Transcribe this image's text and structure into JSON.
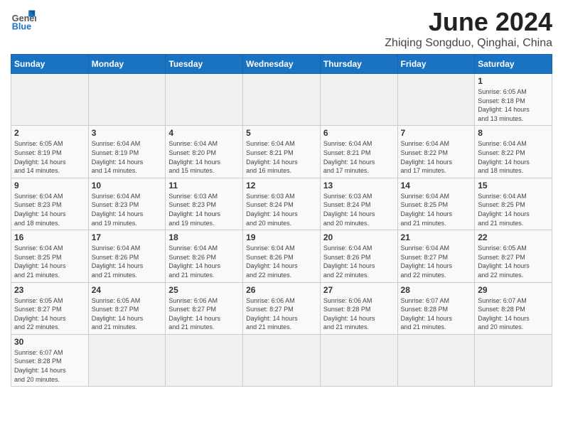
{
  "logo": {
    "text_general": "General",
    "text_blue": "Blue"
  },
  "title": "June 2024",
  "location": "Zhiqing Songduo, Qinghai, China",
  "weekdays": [
    "Sunday",
    "Monday",
    "Tuesday",
    "Wednesday",
    "Thursday",
    "Friday",
    "Saturday"
  ],
  "days": [
    {
      "date": "",
      "info": ""
    },
    {
      "date": "",
      "info": ""
    },
    {
      "date": "",
      "info": ""
    },
    {
      "date": "",
      "info": ""
    },
    {
      "date": "",
      "info": ""
    },
    {
      "date": "",
      "info": ""
    },
    {
      "date": "1",
      "info": "Sunrise: 6:05 AM\nSunset: 8:18 PM\nDaylight: 14 hours\nand 13 minutes."
    },
    {
      "date": "2",
      "info": "Sunrise: 6:05 AM\nSunset: 8:19 PM\nDaylight: 14 hours\nand 14 minutes."
    },
    {
      "date": "3",
      "info": "Sunrise: 6:04 AM\nSunset: 8:19 PM\nDaylight: 14 hours\nand 14 minutes."
    },
    {
      "date": "4",
      "info": "Sunrise: 6:04 AM\nSunset: 8:20 PM\nDaylight: 14 hours\nand 15 minutes."
    },
    {
      "date": "5",
      "info": "Sunrise: 6:04 AM\nSunset: 8:21 PM\nDaylight: 14 hours\nand 16 minutes."
    },
    {
      "date": "6",
      "info": "Sunrise: 6:04 AM\nSunset: 8:21 PM\nDaylight: 14 hours\nand 17 minutes."
    },
    {
      "date": "7",
      "info": "Sunrise: 6:04 AM\nSunset: 8:22 PM\nDaylight: 14 hours\nand 17 minutes."
    },
    {
      "date": "8",
      "info": "Sunrise: 6:04 AM\nSunset: 8:22 PM\nDaylight: 14 hours\nand 18 minutes."
    },
    {
      "date": "9",
      "info": "Sunrise: 6:04 AM\nSunset: 8:23 PM\nDaylight: 14 hours\nand 18 minutes."
    },
    {
      "date": "10",
      "info": "Sunrise: 6:04 AM\nSunset: 8:23 PM\nDaylight: 14 hours\nand 19 minutes."
    },
    {
      "date": "11",
      "info": "Sunrise: 6:03 AM\nSunset: 8:23 PM\nDaylight: 14 hours\nand 19 minutes."
    },
    {
      "date": "12",
      "info": "Sunrise: 6:03 AM\nSunset: 8:24 PM\nDaylight: 14 hours\nand 20 minutes."
    },
    {
      "date": "13",
      "info": "Sunrise: 6:03 AM\nSunset: 8:24 PM\nDaylight: 14 hours\nand 20 minutes."
    },
    {
      "date": "14",
      "info": "Sunrise: 6:04 AM\nSunset: 8:25 PM\nDaylight: 14 hours\nand 21 minutes."
    },
    {
      "date": "15",
      "info": "Sunrise: 6:04 AM\nSunset: 8:25 PM\nDaylight: 14 hours\nand 21 minutes."
    },
    {
      "date": "16",
      "info": "Sunrise: 6:04 AM\nSunset: 8:25 PM\nDaylight: 14 hours\nand 21 minutes."
    },
    {
      "date": "17",
      "info": "Sunrise: 6:04 AM\nSunset: 8:26 PM\nDaylight: 14 hours\nand 21 minutes."
    },
    {
      "date": "18",
      "info": "Sunrise: 6:04 AM\nSunset: 8:26 PM\nDaylight: 14 hours\nand 21 minutes."
    },
    {
      "date": "19",
      "info": "Sunrise: 6:04 AM\nSunset: 8:26 PM\nDaylight: 14 hours\nand 22 minutes."
    },
    {
      "date": "20",
      "info": "Sunrise: 6:04 AM\nSunset: 8:26 PM\nDaylight: 14 hours\nand 22 minutes."
    },
    {
      "date": "21",
      "info": "Sunrise: 6:04 AM\nSunset: 8:27 PM\nDaylight: 14 hours\nand 22 minutes."
    },
    {
      "date": "22",
      "info": "Sunrise: 6:05 AM\nSunset: 8:27 PM\nDaylight: 14 hours\nand 22 minutes."
    },
    {
      "date": "23",
      "info": "Sunrise: 6:05 AM\nSunset: 8:27 PM\nDaylight: 14 hours\nand 22 minutes."
    },
    {
      "date": "24",
      "info": "Sunrise: 6:05 AM\nSunset: 8:27 PM\nDaylight: 14 hours\nand 21 minutes."
    },
    {
      "date": "25",
      "info": "Sunrise: 6:06 AM\nSunset: 8:27 PM\nDaylight: 14 hours\nand 21 minutes."
    },
    {
      "date": "26",
      "info": "Sunrise: 6:06 AM\nSunset: 8:27 PM\nDaylight: 14 hours\nand 21 minutes."
    },
    {
      "date": "27",
      "info": "Sunrise: 6:06 AM\nSunset: 8:28 PM\nDaylight: 14 hours\nand 21 minutes."
    },
    {
      "date": "28",
      "info": "Sunrise: 6:07 AM\nSunset: 8:28 PM\nDaylight: 14 hours\nand 21 minutes."
    },
    {
      "date": "29",
      "info": "Sunrise: 6:07 AM\nSunset: 8:28 PM\nDaylight: 14 hours\nand 20 minutes."
    },
    {
      "date": "30",
      "info": "Sunrise: 6:07 AM\nSunset: 8:28 PM\nDaylight: 14 hours\nand 20 minutes."
    },
    {
      "date": "",
      "info": ""
    },
    {
      "date": "",
      "info": ""
    },
    {
      "date": "",
      "info": ""
    },
    {
      "date": "",
      "info": ""
    },
    {
      "date": "",
      "info": ""
    },
    {
      "date": "",
      "info": ""
    }
  ]
}
